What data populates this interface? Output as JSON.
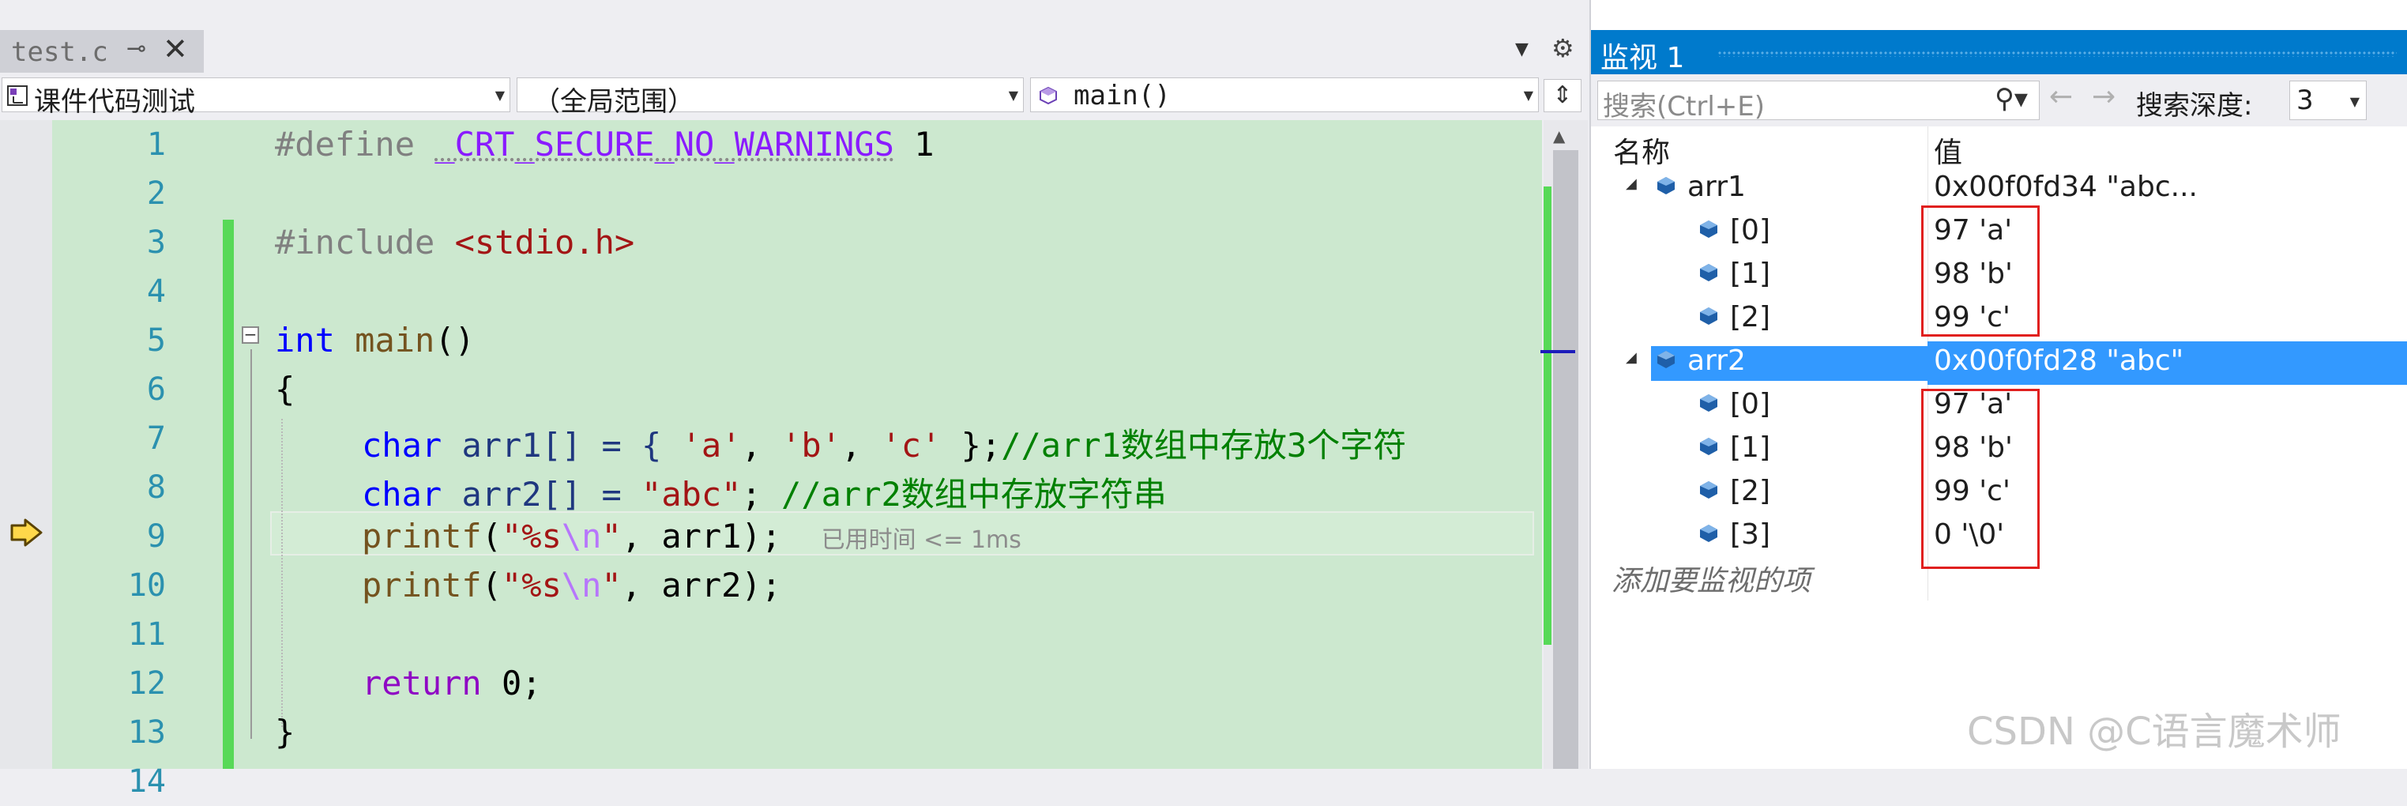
{
  "editor": {
    "tab": {
      "name": "test.c",
      "pin": "⊸",
      "close": "✕"
    },
    "nav": {
      "project": "课件代码测试",
      "scope": "（全局范围）",
      "member": "main()"
    },
    "lines": [
      {
        "n": "1"
      },
      {
        "n": "2"
      },
      {
        "n": "3"
      },
      {
        "n": "4"
      },
      {
        "n": "5"
      },
      {
        "n": "6"
      },
      {
        "n": "7"
      },
      {
        "n": "8"
      },
      {
        "n": "9"
      },
      {
        "n": "10"
      },
      {
        "n": "11"
      },
      {
        "n": "12"
      },
      {
        "n": "13"
      },
      {
        "n": "14"
      }
    ],
    "code": {
      "l1_define": "#define",
      "l1_macro": "_CRT_SECURE_NO_WARNINGS",
      "l1_value": "1",
      "l3_include": "#include",
      "l3_header": "<stdio.h>",
      "l5_int": "int",
      "l5_main": "main",
      "l5_parens": "()",
      "l6": "{",
      "l7_char": "char",
      "l7_rest1": "arr1[] = { ",
      "l7_a": "'a'",
      "l7_comma1": ", ",
      "l7_b": "'b'",
      "l7_comma2": ", ",
      "l7_c": "'c'",
      "l7_rest2": " };",
      "l7_comment": "//arr1数组中存放3个字符",
      "l8_char": "char",
      "l8_rest1": "arr2[] = ",
      "l8_str": "\"abc\"",
      "l8_semi": "; ",
      "l8_comment": "//arr2数组中存放字符串",
      "l9_printf": "printf",
      "l9_open": "(",
      "l9_str1": "\"%s",
      "l9_esc": "\\n",
      "l9_str2": "\"",
      "l9_rest": ", arr1);",
      "l9_perf": "已用时间 <= 1ms",
      "l10_printf": "printf",
      "l10_open": "(",
      "l10_str1": "\"%s",
      "l10_esc": "\\n",
      "l10_str2": "\"",
      "l10_rest": ", arr2);",
      "l12_return": "return",
      "l12_rest": " 0;",
      "l13": "}"
    }
  },
  "watch": {
    "title": "监视 1",
    "search_placeholder": "搜索(Ctrl+E)",
    "depth_label": "搜索深度:",
    "depth_value": "3",
    "col_name": "名称",
    "col_value": "值",
    "rows": [
      {
        "name": "arr1",
        "value": "0x00f0fd34 \"abc..."
      },
      {
        "name": "[0]",
        "value": "97 'a'"
      },
      {
        "name": "[1]",
        "value": "98 'b'"
      },
      {
        "name": "[2]",
        "value": "99 'c'"
      },
      {
        "name": "arr2",
        "value": "0x00f0fd28 \"abc\""
      },
      {
        "name": "[0]",
        "value": "97 'a'"
      },
      {
        "name": "[1]",
        "value": "98 'b'"
      },
      {
        "name": "[2]",
        "value": "99 'c'"
      },
      {
        "name": "[3]",
        "value": "0 '\\0'"
      }
    ],
    "add_item": "添加要监视的项"
  },
  "watermark": "CSDN @C语言魔术师",
  "colors": {
    "accent": "#007acc",
    "selection": "#3399ff",
    "code_bg": "#cce8cf",
    "change_bar": "#57d957",
    "highlight_box": "#e0201f"
  },
  "icons": [
    "pin-icon",
    "close-icon",
    "gear-icon",
    "split-icon",
    "search-icon",
    "back-arrow-icon",
    "forward-arrow-icon",
    "variable-icon",
    "expand-toggle-icon",
    "execution-arrow-icon",
    "collapse-icon"
  ]
}
